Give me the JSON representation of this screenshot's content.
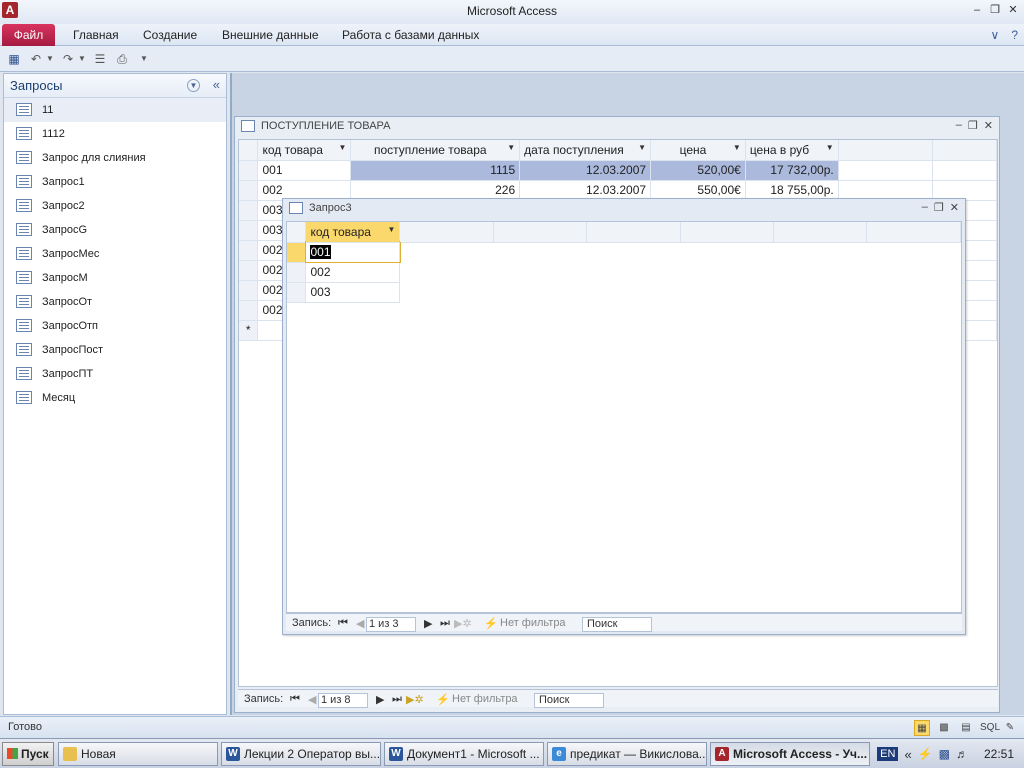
{
  "app": {
    "title": "Microsoft Access",
    "icon_letter": "A"
  },
  "ribbon": {
    "file_tab": "Файл",
    "tabs": [
      "Главная",
      "Создание",
      "Внешние данные",
      "Работа с базами данных"
    ]
  },
  "nav_pane": {
    "title": "Запросы",
    "items": [
      "11",
      "1112",
      "Запрос для слияния",
      "Запрос1",
      "Запрос2",
      "ЗапросG",
      "ЗапросМес",
      "ЗапросМ",
      "ЗапросОт",
      "ЗапросОтп",
      "ЗапросПост",
      "ЗапросПТ",
      "Месяц"
    ],
    "selected_index": 0
  },
  "table_window": {
    "title": "ПОСТУПЛЕНИЕ ТОВАРА",
    "columns": [
      "код товара",
      "поступление товара",
      "дата поступления",
      "цена",
      "цена в руб"
    ],
    "rows": [
      {
        "code": "001",
        "qty": "1115",
        "date": "12.03.2007",
        "price": "520,00€",
        "price_rub": "17 732,00р."
      },
      {
        "code": "002",
        "qty": "226",
        "date": "12.03.2007",
        "price": "550,00€",
        "price_rub": "18 755,00р."
      },
      {
        "code": "003",
        "qty": "",
        "date": "",
        "price": "",
        "price_rub": ""
      },
      {
        "code": "003",
        "qty": "",
        "date": "",
        "price": "",
        "price_rub": ""
      },
      {
        "code": "002",
        "qty": "",
        "date": "",
        "price": "",
        "price_rub": ""
      },
      {
        "code": "002",
        "qty": "",
        "date": "",
        "price": "",
        "price_rub": ""
      },
      {
        "code": "002",
        "qty": "",
        "date": "",
        "price": "",
        "price_rub": ""
      },
      {
        "code": "002",
        "qty": "",
        "date": "",
        "price": "",
        "price_rub": ""
      }
    ],
    "new_row_marker": "*",
    "nav": {
      "label": "Запись:",
      "position": "1 из 8",
      "filter": "Нет фильтра",
      "search": "Поиск"
    }
  },
  "query_window": {
    "title": "Запрос3",
    "columns": [
      "код товара"
    ],
    "rows": [
      "001",
      "002",
      "003"
    ],
    "nav": {
      "label": "Запись:",
      "position": "1 из 3",
      "filter": "Нет фильтра",
      "search": "Поиск"
    }
  },
  "status_bar": {
    "text": "Готово",
    "views": [
      "datasheet-view",
      "pivot-table",
      "pivot-chart",
      "SQL",
      "design-view"
    ]
  },
  "taskbar": {
    "start": "Пуск",
    "buttons": [
      {
        "label": "Новая",
        "icon": "folder-icon"
      },
      {
        "label": "Лекции 2 Оператор вы...",
        "icon": "word-icon"
      },
      {
        "label": "Документ1 - Microsoft ...",
        "icon": "word-icon"
      },
      {
        "label": "предикат — Викислова...",
        "icon": "ie-icon"
      },
      {
        "label": "Microsoft Access - Уч...",
        "icon": "access-icon"
      }
    ],
    "lang": "EN",
    "time": "22:51"
  },
  "colors": {
    "file_tab": "#c2255a",
    "selected_row": "#aab9dc",
    "active_header": "#fbd86b"
  }
}
